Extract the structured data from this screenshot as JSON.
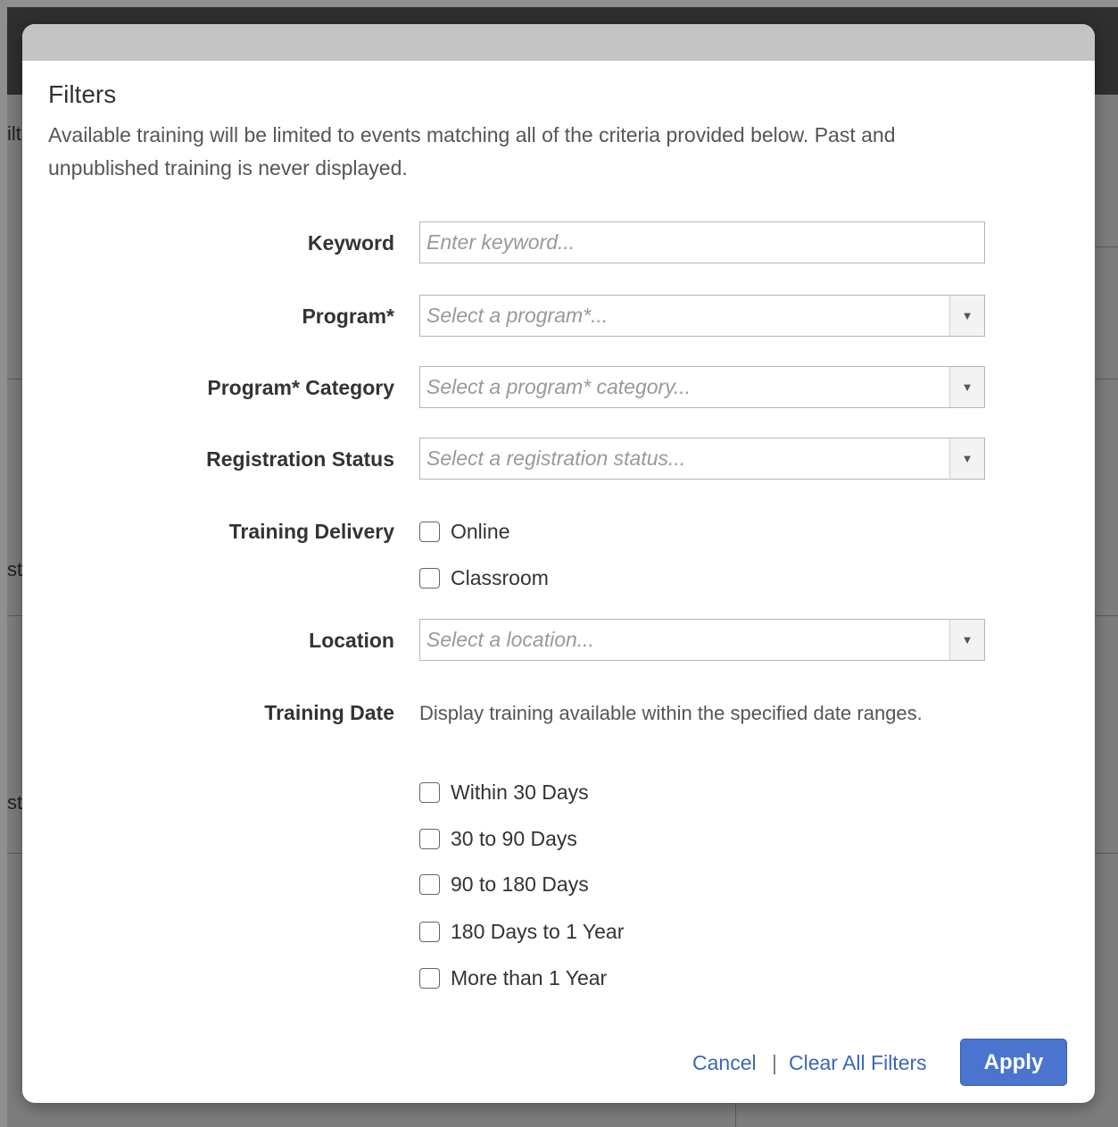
{
  "background": {
    "fragments": [
      "ilt",
      "st",
      "st"
    ]
  },
  "modal": {
    "title": "Filters",
    "description": "Available training will be limited to events matching all of the criteria provided below. Past and unpublished training is never displayed.",
    "fields": {
      "keyword": {
        "label": "Keyword",
        "placeholder": "Enter keyword..."
      },
      "program": {
        "label": "Program*",
        "placeholder": "Select a program*..."
      },
      "program_category": {
        "label": "Program* Category",
        "placeholder": "Select a program* category..."
      },
      "registration_status": {
        "label": "Registration Status",
        "placeholder": "Select a registration status..."
      },
      "location": {
        "label": "Location",
        "placeholder": "Select a location..."
      }
    },
    "training_delivery": {
      "label": "Training Delivery",
      "options": [
        "Online",
        "Classroom"
      ]
    },
    "training_date": {
      "label": "Training Date",
      "help": "Display training available within the specified date ranges.",
      "options": [
        "Within 30 Days",
        "30 to 90 Days",
        "90 to 180 Days",
        "180 Days to 1 Year",
        "More than 1 Year"
      ]
    },
    "footer": {
      "cancel": "Cancel",
      "separator": "|",
      "clear": "Clear All Filters",
      "apply": "Apply"
    }
  },
  "colors": {
    "accent": "#4a74cd",
    "link": "#3b67b8",
    "arrow": "#4472c4"
  }
}
